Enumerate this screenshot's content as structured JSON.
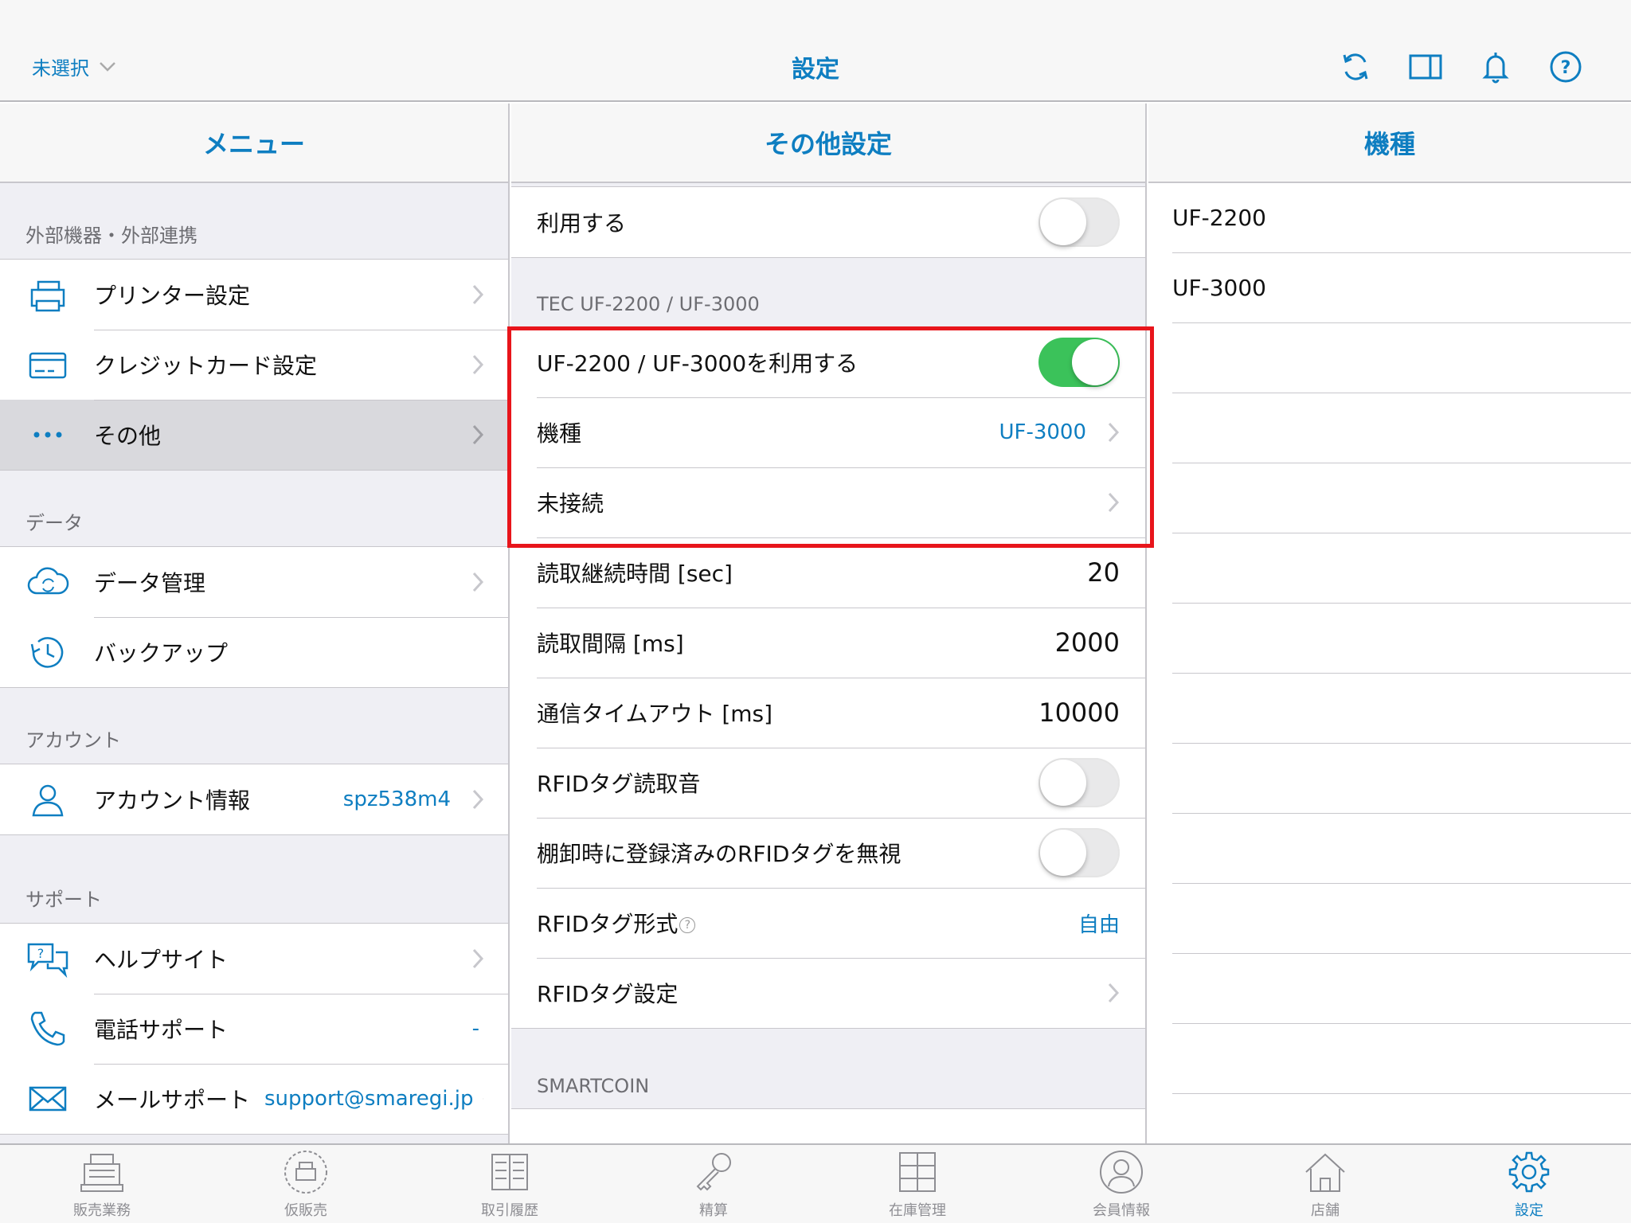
{
  "nav": {
    "left_label": "未選択",
    "title": "設定"
  },
  "menu": {
    "header": "メニュー",
    "sections": [
      {
        "title": "外部機器・外部連携",
        "items": [
          {
            "label": "プリンター設定",
            "icon": "printer-icon"
          },
          {
            "label": "クレジットカード設定",
            "icon": "credit-card-icon"
          },
          {
            "label": "その他",
            "icon": "more-dots-icon",
            "selected": true
          }
        ]
      },
      {
        "title": "データ",
        "items": [
          {
            "label": "データ管理",
            "icon": "cloud-sync-icon"
          },
          {
            "label": "バックアップ",
            "icon": "history-clock-icon"
          }
        ]
      },
      {
        "title": "アカウント",
        "items": [
          {
            "label": "アカウント情報",
            "value": "spz538m4",
            "icon": "user-icon"
          }
        ]
      },
      {
        "title": "サポート",
        "items": [
          {
            "label": "ヘルプサイト",
            "icon": "help-chat-icon"
          },
          {
            "label": "電話サポート",
            "value": "-",
            "icon": "phone-icon"
          },
          {
            "label": "メールサポート",
            "value": "support@smaregi.jp",
            "icon": "mail-icon"
          }
        ]
      }
    ]
  },
  "other": {
    "header": "その他設定",
    "top_row": {
      "label": "利用する",
      "toggle": false
    },
    "tec_section": "TEC UF-2200 / UF-3000",
    "rows": {
      "use_uf": {
        "label": "UF-2200 / UF-3000を利用する",
        "toggle": true
      },
      "model": {
        "label": "機種",
        "value": "UF-3000"
      },
      "connection": {
        "label": "未接続"
      },
      "read_time": {
        "label": "読取継続時間 [sec]",
        "value": "20"
      },
      "read_interval": {
        "label": "読取間隔 [ms]",
        "value": "2000"
      },
      "timeout": {
        "label": "通信タイムアウト [ms]",
        "value": "10000"
      },
      "read_sound": {
        "label": "RFIDタグ読取音",
        "toggle": false
      },
      "ignore_registered": {
        "label": "棚卸時に登録済みのRFIDタグを無視",
        "toggle": false
      },
      "tag_format": {
        "label": "RFIDタグ形式",
        "help": "?",
        "value": "自由"
      },
      "tag_settings": {
        "label": "RFIDタグ設定"
      }
    },
    "smartcoin_section": "SMARTCOIN"
  },
  "models": {
    "header": "機種",
    "items": [
      "UF-2200",
      "UF-3000"
    ]
  },
  "tabs": [
    {
      "label": "販売業務",
      "icon": "register-icon"
    },
    {
      "label": "仮販売",
      "icon": "temp-register-icon"
    },
    {
      "label": "取引履歴",
      "icon": "receipt-list-icon"
    },
    {
      "label": "精算",
      "icon": "key-icon"
    },
    {
      "label": "在庫管理",
      "icon": "shelves-icon"
    },
    {
      "label": "会員情報",
      "icon": "member-icon"
    },
    {
      "label": "店舗",
      "icon": "store-icon"
    },
    {
      "label": "設定",
      "icon": "settings-gear-icon",
      "active": true
    }
  ],
  "colors": {
    "accent": "#0e7ec1",
    "toggle_on": "#3bc25a",
    "highlight": "#e8151b"
  }
}
